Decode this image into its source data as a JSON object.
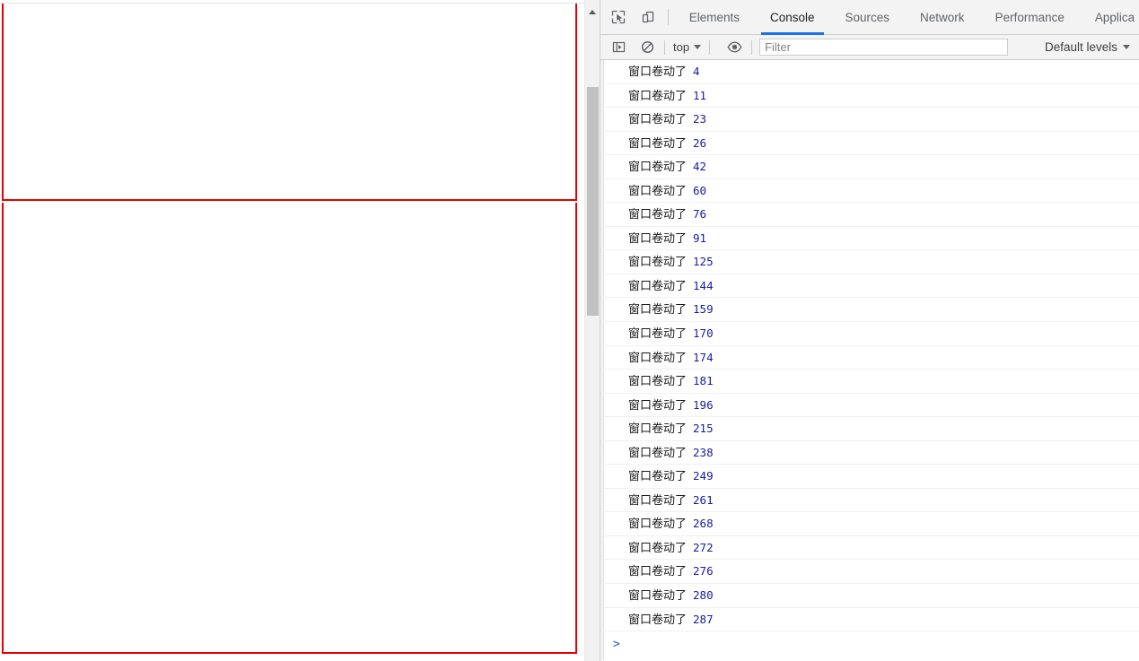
{
  "page": {
    "description": "blank demo page with two red-bordered scroll boxes",
    "red_border_color": "#e60000",
    "background": "#ffffff"
  },
  "scrollbar": {
    "arrow_up_icon": "triangle-up-icon",
    "thumb_color": "#c1c1c1",
    "track_color": "#f1f1f1"
  },
  "devtools": {
    "tabbar": {
      "inspect_icon": "inspect-element-icon",
      "device_icon": "device-toolbar-icon",
      "tabs": [
        {
          "label": "Elements",
          "active": false
        },
        {
          "label": "Console",
          "active": true
        },
        {
          "label": "Sources",
          "active": false
        },
        {
          "label": "Network",
          "active": false
        },
        {
          "label": "Performance",
          "active": false
        },
        {
          "label": "Applica",
          "active": false
        }
      ],
      "active_underline_color": "#1a73e8"
    },
    "toolbar": {
      "sidebar_icon": "console-sidebar-icon",
      "clear_icon": "clear-console-icon",
      "context_label": "top",
      "eye_icon": "live-expression-eye-icon",
      "filter_placeholder": "Filter",
      "filter_value": "",
      "levels_label": "Default levels"
    },
    "console": {
      "message_prefix": "窗口卷动了",
      "messages": [
        {
          "text": "窗口卷动了",
          "value": "4"
        },
        {
          "text": "窗口卷动了",
          "value": "11"
        },
        {
          "text": "窗口卷动了",
          "value": "23"
        },
        {
          "text": "窗口卷动了",
          "value": "26"
        },
        {
          "text": "窗口卷动了",
          "value": "42"
        },
        {
          "text": "窗口卷动了",
          "value": "60"
        },
        {
          "text": "窗口卷动了",
          "value": "76"
        },
        {
          "text": "窗口卷动了",
          "value": "91"
        },
        {
          "text": "窗口卷动了",
          "value": "125"
        },
        {
          "text": "窗口卷动了",
          "value": "144"
        },
        {
          "text": "窗口卷动了",
          "value": "159"
        },
        {
          "text": "窗口卷动了",
          "value": "170"
        },
        {
          "text": "窗口卷动了",
          "value": "174"
        },
        {
          "text": "窗口卷动了",
          "value": "181"
        },
        {
          "text": "窗口卷动了",
          "value": "196"
        },
        {
          "text": "窗口卷动了",
          "value": "215"
        },
        {
          "text": "窗口卷动了",
          "value": "238"
        },
        {
          "text": "窗口卷动了",
          "value": "249"
        },
        {
          "text": "窗口卷动了",
          "value": "261"
        },
        {
          "text": "窗口卷动了",
          "value": "268"
        },
        {
          "text": "窗口卷动了",
          "value": "272"
        },
        {
          "text": "窗口卷动了",
          "value": "276"
        },
        {
          "text": "窗口卷动了",
          "value": "280"
        },
        {
          "text": "窗口卷动了",
          "value": "287"
        }
      ],
      "prompt_symbol": ">",
      "prompt_value": "",
      "value_color": "#1a1aa6"
    }
  }
}
